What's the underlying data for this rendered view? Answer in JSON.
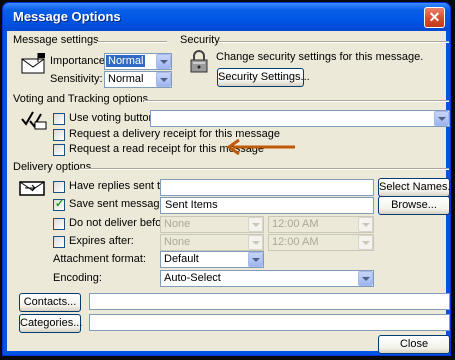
{
  "window": {
    "title": "Message Options",
    "close_glyph": "✕"
  },
  "message_settings": {
    "title": "Message settings",
    "importance_label": "Importance:",
    "importance_value": "Normal",
    "sensitivity_label": "Sensitivity:",
    "sensitivity_value": "Normal",
    "icon": "envelope-flag-icon"
  },
  "security": {
    "title": "Security",
    "text": "Change security settings for this message.",
    "button": "Security Settings...",
    "icon": "padlock-icon"
  },
  "voting": {
    "title": "Voting and Tracking options",
    "use_voting_label": "Use voting buttons:",
    "use_voting_checked": false,
    "use_voting_value": "",
    "delivery_receipt_label": "Request a delivery receipt for this message",
    "delivery_receipt_checked": false,
    "read_receipt_label": "Request a read receipt for this message",
    "read_receipt_checked": false,
    "icon": "checkmark-envelope-icon"
  },
  "delivery": {
    "title": "Delivery options",
    "replies_label": "Have replies sent to:",
    "replies_checked": false,
    "replies_value": "",
    "select_names_button": "Select Names...",
    "save_sent_label": "Save sent message to:",
    "save_sent_checked": true,
    "save_sent_value": "Sent Items",
    "browse_button": "Browse...",
    "do_not_deliver_label": "Do not deliver before:",
    "do_not_deliver_checked": false,
    "do_not_deliver_date": "None",
    "do_not_deliver_time": "12:00 AM",
    "expires_label": "Expires after:",
    "expires_checked": false,
    "expires_date": "None",
    "expires_time": "12:00 AM",
    "attachment_format_label": "Attachment format:",
    "attachment_format_value": "Default",
    "encoding_label": "Encoding:",
    "encoding_value": "Auto-Select",
    "icon": "delivery-envelope-icon"
  },
  "contacts_button": "Contacts...",
  "contacts_value": "",
  "categories_button": "Categories...",
  "categories_value": "",
  "close_button": "Close",
  "annotation": {
    "arrow_color": "#c05a0a"
  }
}
